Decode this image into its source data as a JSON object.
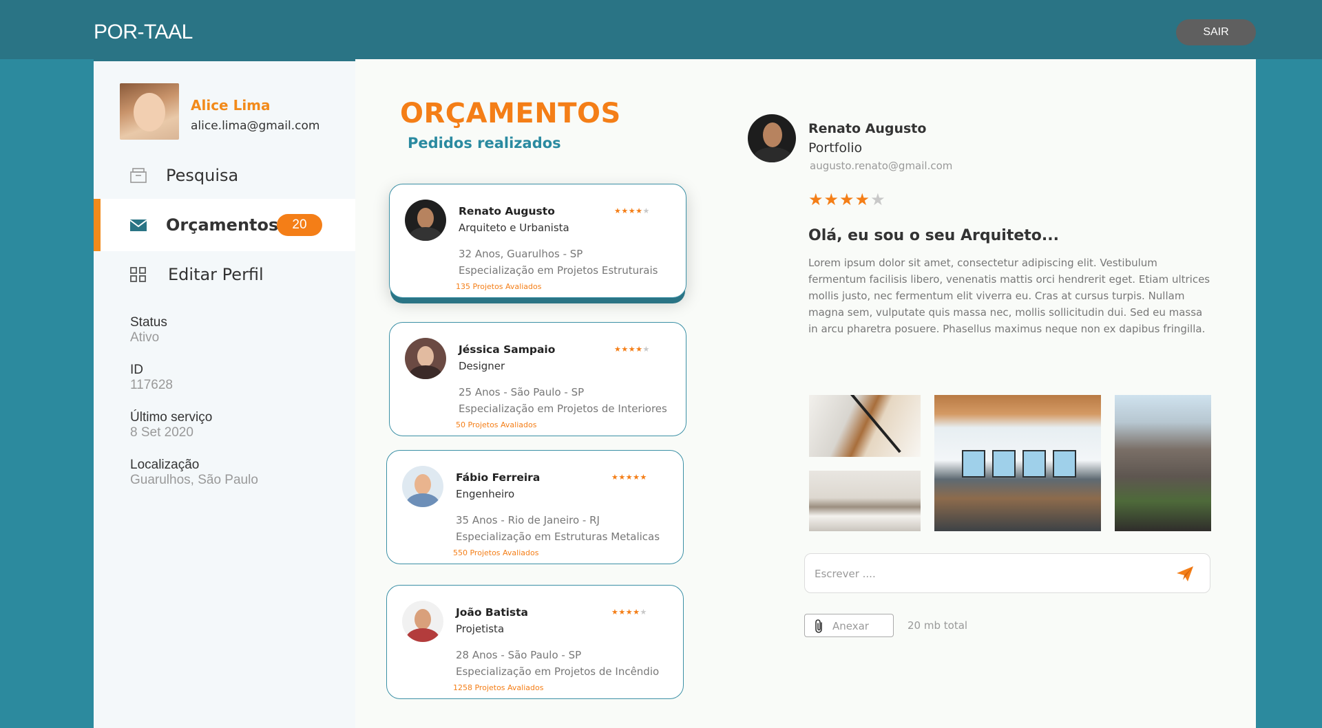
{
  "app": {
    "logo": "POR-TAAL",
    "logout_label": "SAIR"
  },
  "user": {
    "name": "Alice Lima",
    "email": "alice.lima@gmail.com"
  },
  "nav": {
    "search_label": "Pesquisa",
    "quotes_label": "Orçamentos",
    "quotes_count": "20",
    "edit_label": "Editar Perfil"
  },
  "info": [
    {
      "label": "Status",
      "value": "Ativo"
    },
    {
      "label": "ID",
      "value": "117628"
    },
    {
      "label": "Último serviço",
      "value": "8 Set 2020"
    },
    {
      "label": "Localização",
      "value": "Guarulhos, São Paulo"
    }
  ],
  "page": {
    "title": "ORÇAMENTOS",
    "subtitle": "Pedidos realizados"
  },
  "professionals": [
    {
      "name": "Renato Augusto",
      "role": "Arquiteto e Urbanista",
      "age_location": "32 Anos, Guarulhos - SP",
      "specialization": "Especialização em Projetos Estruturais",
      "rated": "135 Projetos Avaliados",
      "stars": 4
    },
    {
      "name": "Jéssica Sampaio",
      "role": "Designer",
      "age_location": "25 Anos - São Paulo - SP",
      "specialization": "Especialização em Projetos de Interiores",
      "rated": "50 Projetos Avaliados",
      "stars": 4
    },
    {
      "name": "Fábio Ferreira",
      "role": "Engenheiro",
      "age_location": "35 Anos - Rio de Janeiro - RJ",
      "specialization": "Especialização em Estruturas Metalicas",
      "rated": "550 Projetos Avaliados",
      "stars": 5
    },
    {
      "name": "João Batista",
      "role": "Projetista",
      "age_location": "28 Anos - São Paulo - SP",
      "specialization": "Especialização em Projetos de Incêndio",
      "rated": "1258 Projetos Avaliados",
      "stars": 4
    }
  ],
  "detail": {
    "name": "Renato Augusto",
    "portfolio_label": "Portfolio",
    "email": "augusto.renato@gmail.com",
    "stars": 4,
    "heading": "Olá, eu sou o seu Arquiteto...",
    "text": "Lorem ipsum dolor sit amet, consectetur adipiscing elit. Vestibulum fermentum facilisis libero, venenatis mattis orci hendrerit eget. Etiam ultrices mollis justo, nec fermentum elit viverra eu. Cras at cursus turpis. Nullam magna sem, vulputate quis massa nec, mollis sollicitudin dui. Sed eu massa in arcu pharetra posuere. Phasellus maximus neque non ex dapibus fringilla. Praesent nec lacinia enim. Curabitur a dui"
  },
  "message": {
    "placeholder": "Escrever ...."
  },
  "attachment": {
    "label": "Anexar",
    "size_total": "20 mb total"
  },
  "colors": {
    "accent": "#f47e17",
    "primary": "#2a7485",
    "subtitle": "#2a8aa0"
  },
  "icons": {
    "search": "box-icon",
    "quotes": "envelope-icon",
    "edit": "grid-icon",
    "send": "paper-plane-icon",
    "attach": "paperclip-icon"
  }
}
